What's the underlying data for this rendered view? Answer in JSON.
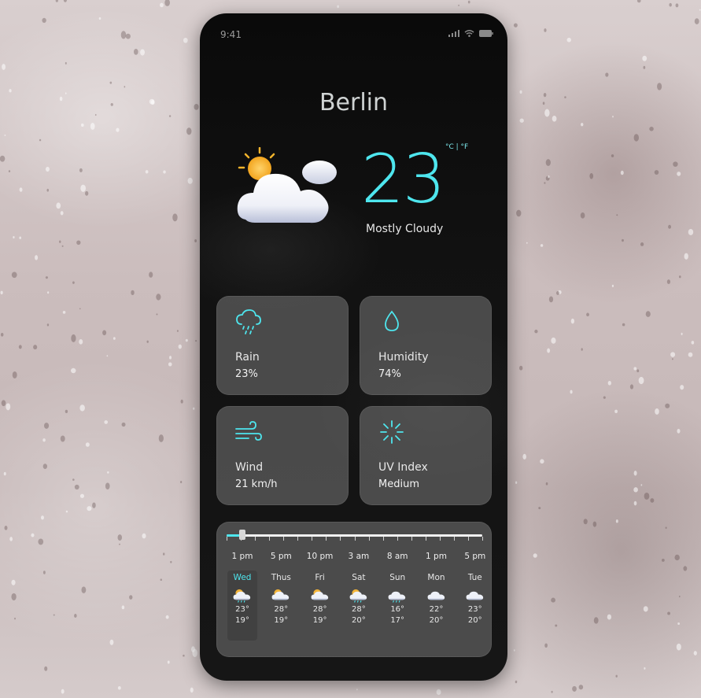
{
  "status": {
    "time": "9:41"
  },
  "location": {
    "city": "Berlin"
  },
  "current": {
    "temperature": "23",
    "condition": "Mostly Cloudy",
    "unit_toggle": "°C | °F",
    "icon": "sun-behind-cloud-icon"
  },
  "stats": [
    {
      "label": "Rain",
      "value": "23%",
      "icon": "rain-cloud-icon"
    },
    {
      "label": "Humidity",
      "value": "74%",
      "icon": "water-drop-icon"
    },
    {
      "label": "Wind",
      "value": "21 km/h",
      "icon": "wind-icon"
    },
    {
      "label": "UV Index",
      "value": "Medium",
      "icon": "sun-rays-icon"
    }
  ],
  "forecast": {
    "timeline_progress": 0.06,
    "times": [
      "1 pm",
      "5 pm",
      "10 pm",
      "3 am",
      "8 am",
      "1 pm",
      "5 pm"
    ],
    "days": [
      {
        "name": "Wed",
        "high": "23°",
        "low": "19°",
        "icon": "sun-cloud-rain-icon",
        "selected": true
      },
      {
        "name": "Thus",
        "high": "28°",
        "low": "19°",
        "icon": "sun-cloud-icon",
        "selected": false
      },
      {
        "name": "Fri",
        "high": "28°",
        "low": "19°",
        "icon": "sun-cloud-icon",
        "selected": false
      },
      {
        "name": "Sat",
        "high": "28°",
        "low": "20°",
        "icon": "sun-cloud-rain-icon",
        "selected": false
      },
      {
        "name": "Sun",
        "high": "16°",
        "low": "17°",
        "icon": "cloud-rain-icon",
        "selected": false
      },
      {
        "name": "Mon",
        "high": "22°",
        "low": "20°",
        "icon": "cloud-icon",
        "selected": false
      },
      {
        "name": "Tue",
        "high": "23°",
        "low": "20°",
        "icon": "cloud-icon",
        "selected": false
      }
    ]
  },
  "colors": {
    "accent": "#4ee6ee",
    "card_bg": "rgba(120,120,120,0.55)",
    "phone_bg": "#0a0a0a"
  }
}
